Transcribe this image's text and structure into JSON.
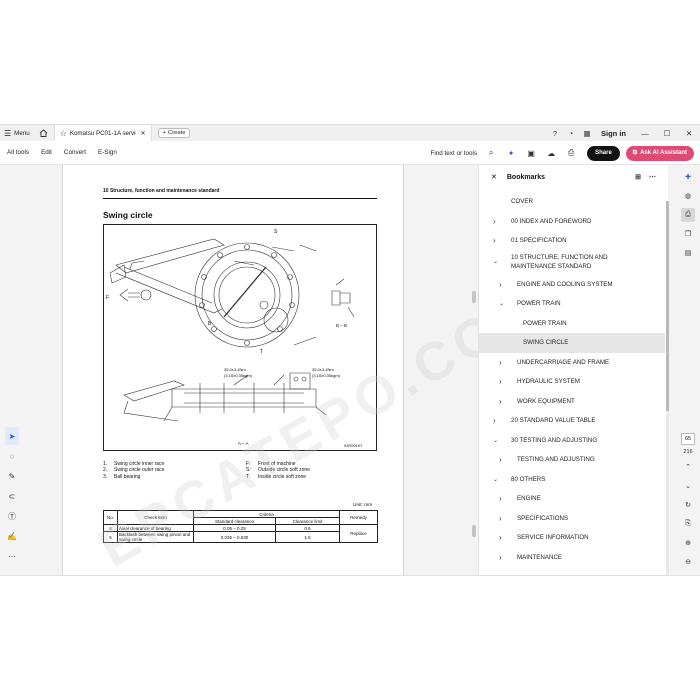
{
  "titlebar": {
    "menu_label": "Menu",
    "tab_title": "Komatsu PC01-1A servic...",
    "create_label": "Create",
    "signin_label": "Sign in"
  },
  "toolbar": {
    "all_tools": "All tools",
    "edit": "Edit",
    "convert": "Convert",
    "esign": "E-Sign",
    "find_label": "Find text or tools",
    "share_label": "Share",
    "ai_label": "Ask AI Assistant"
  },
  "document": {
    "header": "10 Structure, function and maintenance standard",
    "title": "Swing circle",
    "watermark": "EPCATEPO.COM",
    "drawing_labels": {
      "s_top": "S",
      "f_left": "F",
      "t_bottom": "T",
      "b_left": "B",
      "section_bb": "B – B",
      "torque1_line1": "35.0±3.4Nm",
      "torque1_line2": "(3.15±0.35kgm)",
      "torque2_line1": "35.0±3.4Nm",
      "torque2_line2": "(3.15±0.35kgm)",
      "section_aa": "A – A",
      "figure_code": "9JR00197"
    },
    "legend": [
      {
        "num": "1.",
        "text": "Swing circle inner race",
        "code": "F:",
        "desc": "Front of machine"
      },
      {
        "num": "2.",
        "text": "Swing circle outer race",
        "code": "S:",
        "desc": "Outside circle soft zone"
      },
      {
        "num": "3.",
        "text": "Ball bearing",
        "code": "T:",
        "desc": "Inside circle soft zone"
      }
    ],
    "unit_label": "Unit: mm",
    "table": {
      "headers": [
        "No.",
        "Check item",
        "Criteria",
        "Remedy"
      ],
      "subheaders": [
        "Standard clearance",
        "Clearance limit"
      ],
      "rows": [
        {
          "no": "4",
          "item": "Axial clearance of bearing",
          "standard": "0.05 – 0.25",
          "limit": "0.6"
        },
        {
          "no": "5",
          "item": "Backlash between swing pinion and swing circle",
          "standard": "0.036 – 0.630",
          "limit": "1.6"
        }
      ],
      "remedy": "Replace"
    }
  },
  "bookmarks": {
    "title": "Bookmarks",
    "items": [
      {
        "label": "COVER",
        "level": 0,
        "chevron": "none"
      },
      {
        "label": "00 INDEX AND FOREWORD",
        "level": 0,
        "chevron": "right"
      },
      {
        "label": "01 SPECIFICATION",
        "level": 0,
        "chevron": "right"
      },
      {
        "label": "10 STRUCTURE, FUNCTION AND",
        "label2": "MAINTENANCE STANDARD",
        "level": 0,
        "chevron": "down"
      },
      {
        "label": "ENGINE AND COOLING SYSTEM",
        "level": 1,
        "chevron": "right"
      },
      {
        "label": "POWER TRAIN",
        "level": 1,
        "chevron": "down"
      },
      {
        "label": "POWER TRAIN",
        "level": 2,
        "chevron": "none"
      },
      {
        "label": "SWING CIRCLE",
        "level": 2,
        "chevron": "none",
        "selected": true
      },
      {
        "label": "UNDERCARRIAGE AND FRAME",
        "level": 1,
        "chevron": "right"
      },
      {
        "label": "HYDRAULIC SYSTEM",
        "level": 1,
        "chevron": "right"
      },
      {
        "label": "WORK EQUIPMENT",
        "level": 1,
        "chevron": "right"
      },
      {
        "label": "20 STANDARD VALUE TABLE",
        "level": 0,
        "chevron": "right"
      },
      {
        "label": "30 TESTING AND ADJUSTING",
        "level": 0,
        "chevron": "down"
      },
      {
        "label": "TESTING AND ADJUSTING",
        "level": 1,
        "chevron": "right"
      },
      {
        "label": "80 OTHERS",
        "level": 0,
        "chevron": "down"
      },
      {
        "label": "ENGINE",
        "level": 1,
        "chevron": "right"
      },
      {
        "label": "SPECIFICATIONS",
        "level": 1,
        "chevron": "right"
      },
      {
        "label": "SERVICE INFORMATION",
        "level": 1,
        "chevron": "right"
      },
      {
        "label": "MAINTENANCE",
        "level": 1,
        "chevron": "right"
      }
    ]
  },
  "page_nav": {
    "current_page": "65",
    "total_pages": "216"
  }
}
